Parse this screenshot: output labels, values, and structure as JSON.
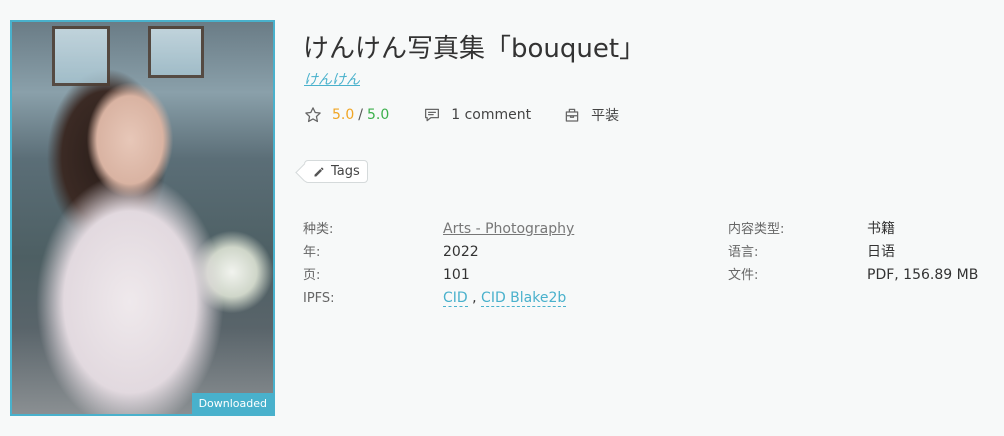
{
  "book": {
    "title": "けんけん写真集「bouquet」",
    "author": "けんけん",
    "cover_badge": "Downloaded",
    "rating_current": "5.0",
    "rating_separator": "/",
    "rating_max": "5.0",
    "comments": "1 comment",
    "binding": "平装",
    "tags_label": "Tags"
  },
  "details_left": {
    "labels": [
      "种类:",
      "年:",
      "页:",
      "IPFS:"
    ],
    "category": "Arts - Photography",
    "year": "2022",
    "pages": "101",
    "ipfs_cid": "CID",
    "ipfs_comma": ",",
    "ipfs_blake": "CID Blake2b"
  },
  "details_right": {
    "labels": [
      "内容类型:",
      "语言:",
      "文件:"
    ],
    "values": [
      "书籍",
      "日语",
      "PDF, 156.89 MB"
    ]
  },
  "icons": [
    "star-icon",
    "comment-icon",
    "box-icon",
    "pencil-icon"
  ],
  "colors": {
    "accent": "#49b1cc",
    "rating": "#f0a524",
    "rating_max": "#3cb04c"
  }
}
